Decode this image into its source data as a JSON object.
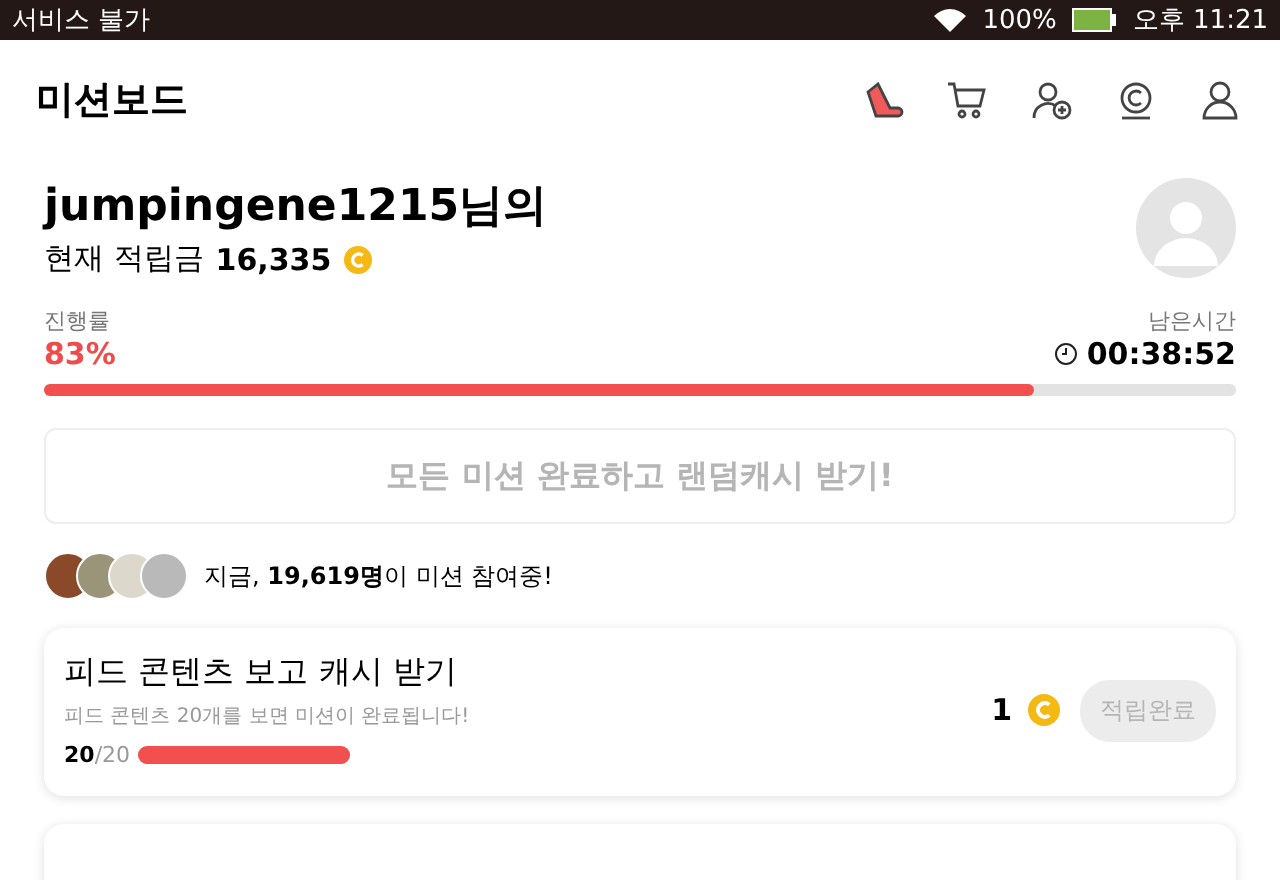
{
  "status_bar": {
    "carrier": "서비스 불가",
    "battery": "100%",
    "time": "오후 11:21"
  },
  "header": {
    "title": "미션보드"
  },
  "profile": {
    "name": "jumpingene1215님의",
    "balance_label": "현재 적립금",
    "balance": "16,335"
  },
  "progress": {
    "label": "진행률",
    "value": "83%",
    "level": 0.83,
    "time_label": "남은시간",
    "time": "00:38:52"
  },
  "bonus_button": "모든 미션 완료하고 랜덤캐시 받기!",
  "participants": {
    "prefix": "지금, ",
    "count": "19,619명",
    "suffix": "이 미션 참여중!"
  },
  "missions": [
    {
      "title": "피드 콘텐츠 보고 캐시 받기",
      "description": "피드 콘텐츠 20개를 보면 미션이 완료됩니다!",
      "done": "20",
      "total": "/20",
      "level": 1,
      "reward": "1",
      "button": "적립완료",
      "completed": true
    }
  ]
}
